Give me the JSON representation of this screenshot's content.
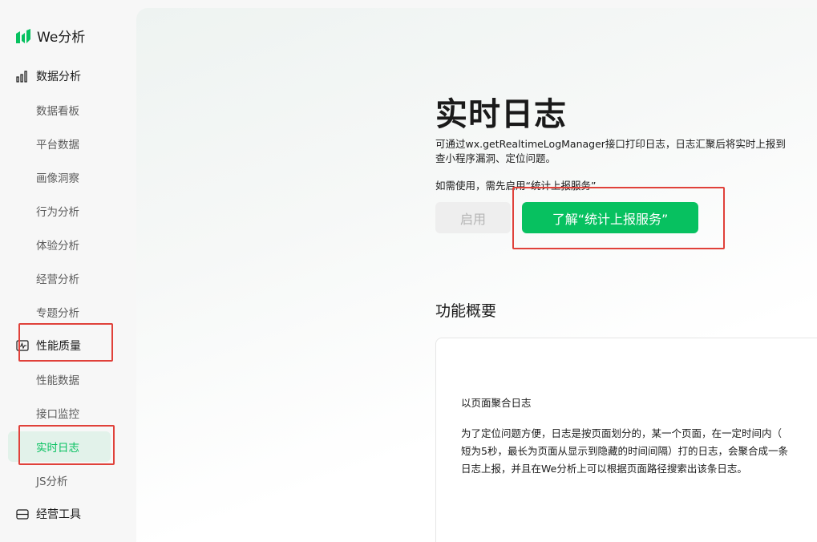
{
  "app": {
    "logo_text": "We分析"
  },
  "sidebar": {
    "groups": [
      {
        "label": "数据分析",
        "icon": "bar-chart-icon"
      },
      {
        "label": "性能质量",
        "icon": "monitor-pulse-icon"
      },
      {
        "label": "经营工具",
        "icon": "tool-box-icon"
      }
    ],
    "data_items": [
      "数据看板",
      "平台数据",
      "画像洞察",
      "行为分析",
      "体验分析",
      "经营分析",
      "专题分析"
    ],
    "perf_items": [
      "性能数据",
      "接口监控",
      "实时日志",
      "JS分析"
    ],
    "active_item": "实时日志"
  },
  "main": {
    "title": "实时日志",
    "description_line1": "可通过wx.getRealtimeLogManager接口打印日志，日志汇聚后将实时上报到",
    "description_line2": "查小程序漏洞、定位问题。",
    "note": "如需使用，需先启用“统计上报服务”",
    "enable_button": "启用",
    "learn_button": "了解“统计上报服务”",
    "section_title": "功能概要",
    "card": {
      "subtitle": "以页面聚合日志",
      "body_lines": [
        "为了定位问题方便，日志是按页面划分的，某一个页面，在一定时间内（",
        "短为5秒，最长为页面从显示到隐藏的时间间隔）打的日志，会聚合成一条",
        "日志上报，并且在We分析上可以根据页面路径搜索出该条日志。"
      ]
    }
  },
  "colors": {
    "accent": "#07c160",
    "highlight": "#e0413a",
    "active_bg": "#e2f2ea"
  }
}
